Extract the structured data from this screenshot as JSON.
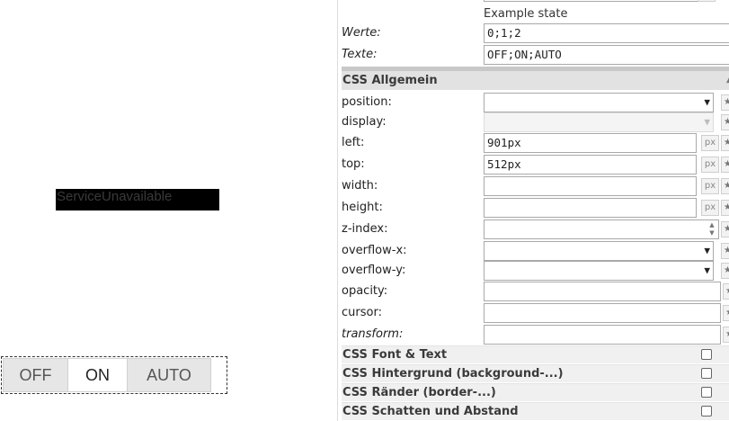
{
  "canvas": {
    "service_text": "ServiceUnavailable",
    "radio_options": [
      "OFF",
      "ON",
      "AUTO"
    ],
    "radio_selected": "ON"
  },
  "inspector": {
    "state_hint": "Example state",
    "values_label": "Werte:",
    "values_value": "0;1;2",
    "texts_label": "Texte:",
    "texts_value": "OFF;ON;AUTO",
    "css_general_title": "CSS Allgemein",
    "fields": {
      "position": {
        "label": "position:",
        "value": ""
      },
      "display": {
        "label": "display:",
        "value": ""
      },
      "left": {
        "label": "left:",
        "value": "901px",
        "unit": "px"
      },
      "top": {
        "label": "top:",
        "value": "512px",
        "unit": "px"
      },
      "width": {
        "label": "width:",
        "value": "",
        "unit": "px"
      },
      "height": {
        "label": "height:",
        "value": "",
        "unit": "px"
      },
      "zindex": {
        "label": "z-index:",
        "value": ""
      },
      "overflowx": {
        "label": "overflow-x:",
        "value": ""
      },
      "overflowy": {
        "label": "overflow-y:",
        "value": ""
      },
      "opacity": {
        "label": "opacity:",
        "value": ""
      },
      "cursor": {
        "label": "cursor:",
        "value": ""
      },
      "transform": {
        "label": "transform:",
        "value": ""
      }
    },
    "sections": [
      {
        "title": "CSS Font & Text",
        "checked": false
      },
      {
        "title": "CSS Hintergrund (background-...)",
        "checked": false
      },
      {
        "title": "CSS Ränder (border-...)",
        "checked": false
      },
      {
        "title": "CSS Schatten und Abstand",
        "checked": false
      }
    ],
    "colors": {
      "section_bg": "#f0f0f0",
      "section_open_bg": "#e2e2e2"
    }
  }
}
